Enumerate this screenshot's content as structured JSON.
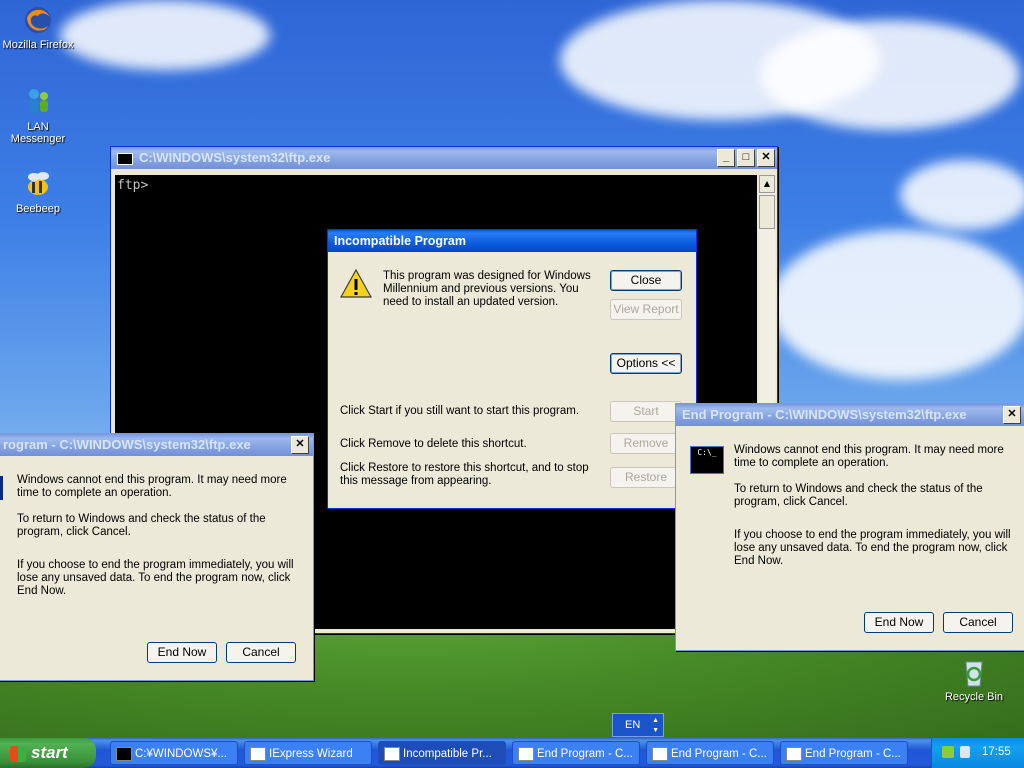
{
  "desktop": {
    "icons": [
      {
        "label": "Mozilla Firefox",
        "icon": "firefox-icon"
      },
      {
        "label": "LAN Messenger",
        "icon": "lan-messenger-icon"
      },
      {
        "label": "Beebeep",
        "icon": "beebeep-icon"
      },
      {
        "label": "Recycle Bin",
        "icon": "recycle-bin-icon"
      }
    ]
  },
  "console": {
    "title": "C:\\WINDOWS\\system32\\ftp.exe",
    "prompt": "ftp>"
  },
  "incompatible": {
    "title": "Incompatible Program",
    "message": "This program was designed for Windows Millennium and previous versions.  You need to install an updated version.",
    "close_label": "Close",
    "view_report_label": "View Report",
    "options_label": "Options <<",
    "start_text": "Click Start if you still want to start this program.",
    "start_label": "Start",
    "remove_text": "Click Remove to delete this shortcut.",
    "remove_label": "Remove",
    "restore_text": "Click Restore to restore this shortcut, and to stop this message from appearing.",
    "restore_label": "Restore"
  },
  "end_program_left": {
    "title": "rogram - C:\\WINDOWS\\system32\\ftp.exe",
    "p1": "Windows cannot end this program. It may need more time to complete an operation.",
    "p2": "To return to Windows and check the status of the program, click Cancel.",
    "p3": "If you choose to end the program immediately, you will lose any unsaved data. To end the program now, click End Now.",
    "end_now_label": "End Now",
    "cancel_label": "Cancel"
  },
  "end_program_right": {
    "title": "End Program - C:\\WINDOWS\\system32\\ftp.exe",
    "p1": "Windows cannot end this program. It may need more time to complete an operation.",
    "p2": "To return to Windows and check the status of the program, click Cancel.",
    "p3": "If you choose to end the program immediately, you will lose any unsaved data. To end the program now, click End Now.",
    "end_now_label": "End Now",
    "cancel_label": "Cancel"
  },
  "language_bar": {
    "label": "EN"
  },
  "taskbar": {
    "start_label": "start",
    "tasks": [
      {
        "label": "C:¥WINDOWS¥..."
      },
      {
        "label": "IExpress Wizard"
      },
      {
        "label": "Incompatible Pr..."
      },
      {
        "label": "End Program - C..."
      },
      {
        "label": "End Program - C..."
      },
      {
        "label": "End Program - C..."
      }
    ],
    "clock": "17:55"
  }
}
